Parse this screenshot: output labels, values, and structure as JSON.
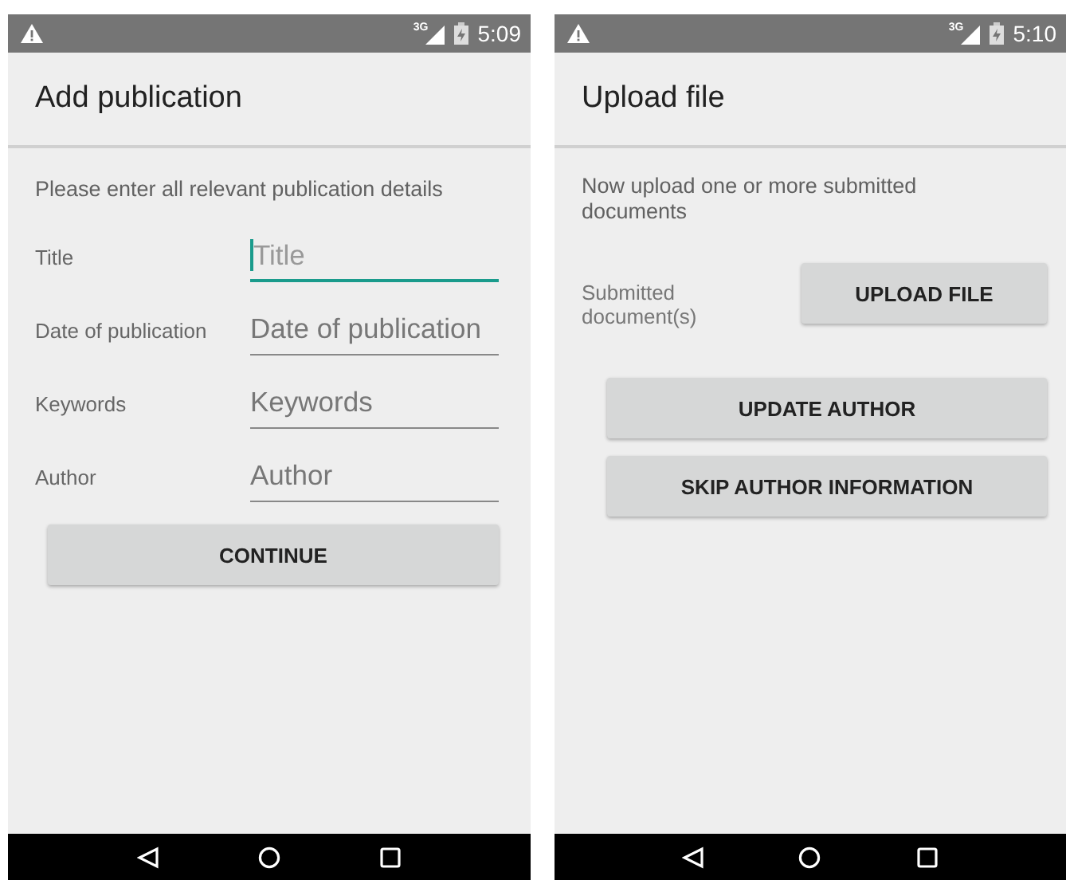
{
  "screens": [
    {
      "status_bar": {
        "network": "3G",
        "time": "5:09"
      },
      "title": "Add publication",
      "description": "Please enter all relevant publication details",
      "fields": [
        {
          "label": "Title",
          "placeholder": "Title",
          "focused": true
        },
        {
          "label": "Date of publication",
          "placeholder": "Date of publication",
          "focused": false
        },
        {
          "label": "Keywords",
          "placeholder": "Keywords",
          "focused": false
        },
        {
          "label": "Author",
          "placeholder": "Author",
          "focused": false
        }
      ],
      "buttons": [
        "CONTINUE"
      ]
    },
    {
      "status_bar": {
        "network": "3G",
        "time": "5:10"
      },
      "title": "Upload file",
      "description": "Now upload one or more submitted documents",
      "upload": {
        "label": "Submitted document(s)",
        "button": "UPLOAD FILE"
      },
      "buttons": [
        "UPDATE AUTHOR",
        "SKIP AUTHOR INFORMATION"
      ]
    }
  ]
}
